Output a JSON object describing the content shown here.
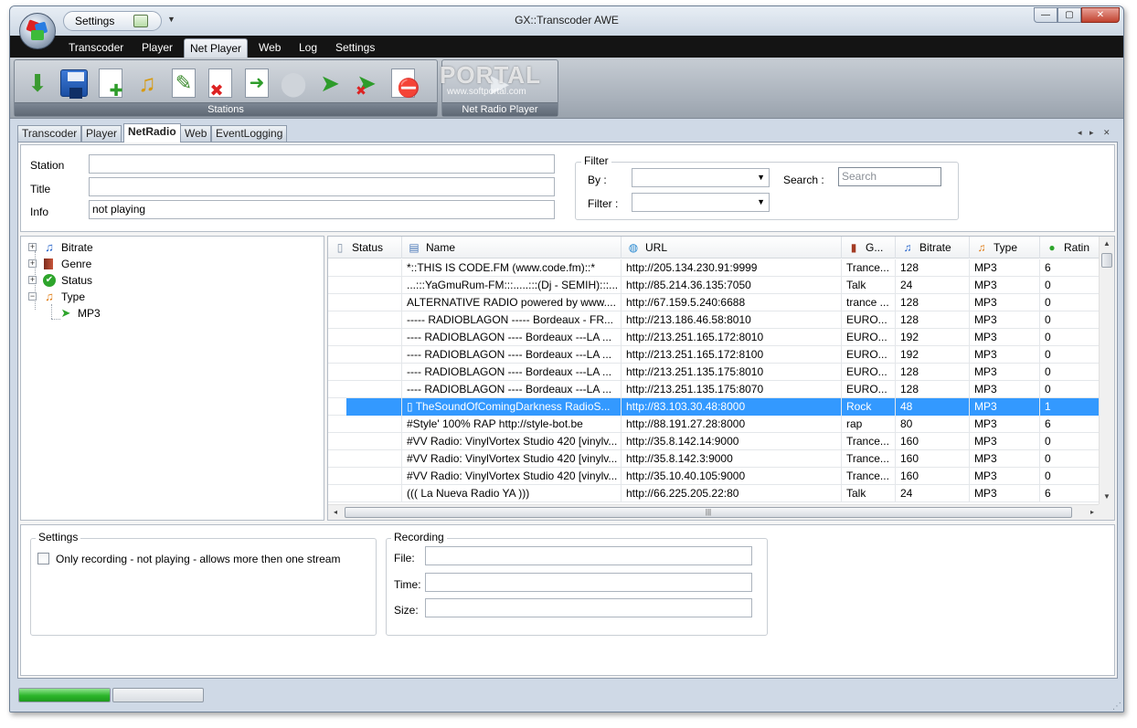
{
  "window": {
    "title": "GX::Transcoder AWE"
  },
  "quick_access": {
    "label": "Settings"
  },
  "window_controls": {
    "minimize": "—",
    "maximize": "▢",
    "close": "✕"
  },
  "ribbon_tabs": [
    "Transcoder",
    "Player",
    "Net Player",
    "Web",
    "Log",
    "Settings"
  ],
  "ribbon_active_tab": "Net Player",
  "ribbon_groups": {
    "stations": "Stations",
    "net_radio_player": "Net Radio Player"
  },
  "ribbon_buttons": [
    {
      "name": "download-icon"
    },
    {
      "name": "save-icon"
    },
    {
      "name": "new-station-icon"
    },
    {
      "name": "open-folder-music-icon"
    },
    {
      "name": "edit-station-icon"
    },
    {
      "name": "delete-station-icon"
    },
    {
      "name": "import-icon"
    },
    {
      "name": "refresh-icon"
    },
    {
      "name": "add-filter-icon"
    },
    {
      "name": "remove-filter-icon"
    },
    {
      "name": "stop-icon"
    },
    {
      "name": "play-icon"
    }
  ],
  "watermark": {
    "text": "PORTAL",
    "sub": "www.softportal.com"
  },
  "doc_tabs": [
    "Transcoder",
    "Player",
    "NetRadio",
    "Web",
    "EventLogging"
  ],
  "doc_active_tab": "NetRadio",
  "doc_tab_controls": {
    "prev": "◂",
    "next": "▸",
    "close": "✕"
  },
  "info": {
    "station_label": "Station",
    "station_value": "",
    "title_label": "Title",
    "title_value": "",
    "info_label": "Info",
    "info_value": "not playing"
  },
  "filter": {
    "title": "Filter",
    "by_label": "By :",
    "filter_label": "Filter :",
    "search_label": "Search :",
    "search_placeholder": "Search"
  },
  "tree": [
    {
      "label": "Bitrate",
      "icon": "music-note-icon",
      "expander": "+"
    },
    {
      "label": "Genre",
      "icon": "book-icon",
      "expander": "+"
    },
    {
      "label": "Status",
      "icon": "check-circle-icon",
      "expander": "+"
    },
    {
      "label": "Type",
      "icon": "music-note-orange-icon",
      "expander": "−"
    },
    {
      "label": "MP3",
      "icon": "cursor-icon",
      "expander": ""
    }
  ],
  "grid": {
    "columns": [
      {
        "key": "status",
        "label": "Status"
      },
      {
        "key": "name",
        "label": "Name"
      },
      {
        "key": "url",
        "label": "URL"
      },
      {
        "key": "genre",
        "label": "G..."
      },
      {
        "key": "bitrate",
        "label": "Bitrate"
      },
      {
        "key": "type",
        "label": "Type"
      },
      {
        "key": "rating",
        "label": "Ratin"
      }
    ],
    "rows": [
      {
        "name": "*::THIS IS CODE.FM (www.code.fm)::*",
        "url": "http://205.134.230.91:9999",
        "genre": "Trance...",
        "bitrate": "128",
        "type": "MP3",
        "rating": "6"
      },
      {
        "name": "...:::YaGmuRum-FM:::.....:::(Dj - SEMIH):::...",
        "url": "http://85.214.36.135:7050",
        "genre": "Talk",
        "bitrate": "24",
        "type": "MP3",
        "rating": "0"
      },
      {
        "name": "ALTERNATIVE RADIO powered by www....",
        "url": "http://67.159.5.240:6688",
        "genre": "trance ...",
        "bitrate": "128",
        "type": "MP3",
        "rating": "0"
      },
      {
        "name": "----- RADIOBLAGON ----- Bordeaux - FR...",
        "url": "http://213.186.46.58:8010",
        "genre": "EURO...",
        "bitrate": "128",
        "type": "MP3",
        "rating": "0"
      },
      {
        "name": "---- RADIOBLAGON ---- Bordeaux ---LA ...",
        "url": "http://213.251.165.172:8010",
        "genre": "EURO...",
        "bitrate": "192",
        "type": "MP3",
        "rating": "0"
      },
      {
        "name": "---- RADIOBLAGON ---- Bordeaux ---LA ...",
        "url": "http://213.251.165.172:8100",
        "genre": "EURO...",
        "bitrate": "192",
        "type": "MP3",
        "rating": "0"
      },
      {
        "name": "---- RADIOBLAGON ---- Bordeaux ---LA ...",
        "url": "http://213.251.135.175:8010",
        "genre": "EURO...",
        "bitrate": "128",
        "type": "MP3",
        "rating": "0"
      },
      {
        "name": "---- RADIOBLAGON ---- Bordeaux ---LA ...",
        "url": "http://213.251.135.175:8070",
        "genre": "EURO...",
        "bitrate": "128",
        "type": "MP3",
        "rating": "0"
      },
      {
        "name": "▯ TheSoundOfComingDarkness RadioS...",
        "url": "http://83.103.30.48:8000",
        "genre": "Rock",
        "bitrate": "48",
        "type": "MP3",
        "rating": "1"
      },
      {
        "name": "#Style' 100% RAP http://style-bot.be",
        "url": "http://88.191.27.28:8000",
        "genre": "rap",
        "bitrate": "80",
        "type": "MP3",
        "rating": "6"
      },
      {
        "name": "#VV Radio: VinylVortex Studio 420 [vinylv...",
        "url": "http://35.8.142.14:9000",
        "genre": "Trance...",
        "bitrate": "160",
        "type": "MP3",
        "rating": "0"
      },
      {
        "name": "#VV Radio: VinylVortex Studio 420 [vinylv...",
        "url": "http://35.8.142.3:9000",
        "genre": "Trance...",
        "bitrate": "160",
        "type": "MP3",
        "rating": "0"
      },
      {
        "name": "#VV Radio: VinylVortex Studio 420 [vinylv...",
        "url": "http://35.10.40.105:9000",
        "genre": "Trance...",
        "bitrate": "160",
        "type": "MP3",
        "rating": "0"
      },
      {
        "name": "((( La Nueva Radio YA )))",
        "url": "http://66.225.205.22:80",
        "genre": "Talk",
        "bitrate": "24",
        "type": "MP3",
        "rating": "6"
      }
    ],
    "selected_row": 8,
    "scroll": {
      "up": "▲",
      "down": "▼",
      "left": "◂",
      "right": "▸",
      "grip": "|||"
    }
  },
  "settings": {
    "title": "Settings",
    "only_recording_label": "Only recording - not playing - allows more then one stream",
    "only_recording_checked": false
  },
  "recording": {
    "title": "Recording",
    "file_label": "File:",
    "file_value": "",
    "time_label": "Time:",
    "time_value": "",
    "size_label": "Size:",
    "size_value": ""
  },
  "status": {
    "progress1": 1.0,
    "progress2": 0.0,
    "grip": "⋰"
  }
}
